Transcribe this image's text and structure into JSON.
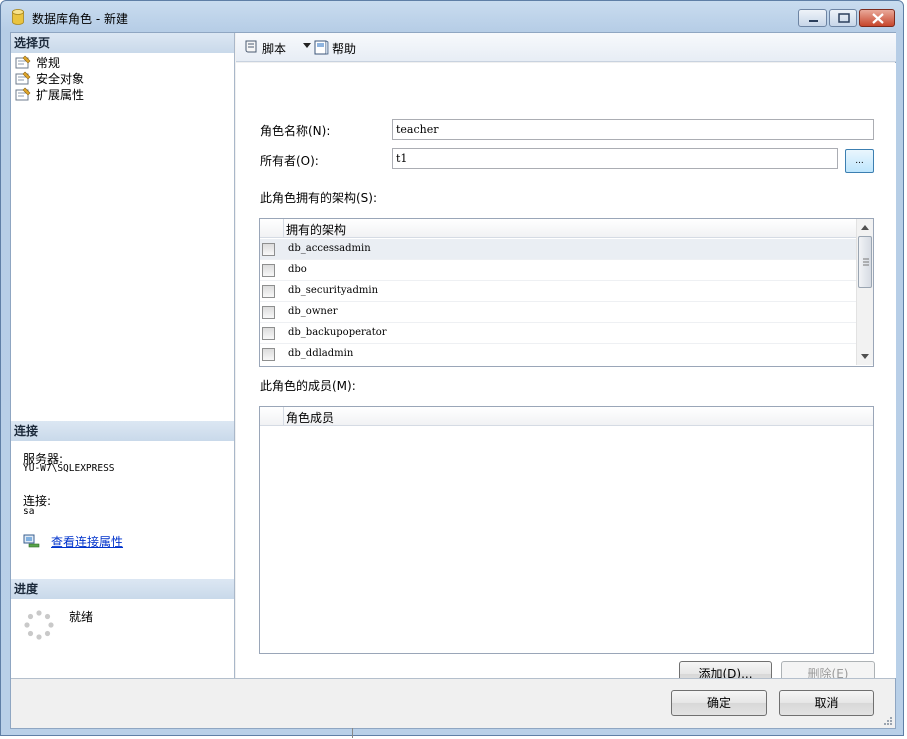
{
  "window": {
    "title": "数据库角色 - 新建"
  },
  "left_panel": {
    "select_page_header": "选择页",
    "pages": [
      {
        "label": "常规",
        "icon": "page-settings-icon"
      },
      {
        "label": "安全对象",
        "icon": "page-settings-icon"
      },
      {
        "label": "扩展属性",
        "icon": "page-settings-icon"
      }
    ],
    "connection_header": "连接",
    "server_label": "服务器:",
    "server_value": "YU-W7\\SQLEXPRESS",
    "connection_label": "连接:",
    "connection_value": "sa",
    "view_props_link": "查看连接属性",
    "progress_header": "进度",
    "progress_status": "就绪"
  },
  "toolbar": {
    "script_label": "脚本",
    "help_label": "帮助"
  },
  "form": {
    "role_name_label": "角色名称(N):",
    "role_name_value": "teacher",
    "owner_label": "所有者(O):",
    "owner_value": "t1",
    "browse_label": "...",
    "schemas_label": "此角色拥有的架构(S):",
    "schemas_column": "拥有的架构",
    "schemas": [
      {
        "name": "db_accessadmin",
        "checked": false
      },
      {
        "name": "dbo",
        "checked": false
      },
      {
        "name": "db_securityadmin",
        "checked": false
      },
      {
        "name": "db_owner",
        "checked": false
      },
      {
        "name": "db_backupoperator",
        "checked": false
      },
      {
        "name": "db_ddladmin",
        "checked": false
      }
    ],
    "members_label": "此角色的成员(M):",
    "members_column": "角色成员",
    "add_button": "添加(D)...",
    "remove_button": "删除(E)"
  },
  "footer": {
    "ok_button": "确定",
    "cancel_button": "取消"
  },
  "colors": {
    "section_header": "#c9d9ea",
    "link": "#0033cc",
    "title_bar": "#b9d0e8",
    "close_button": "#c7462c"
  }
}
